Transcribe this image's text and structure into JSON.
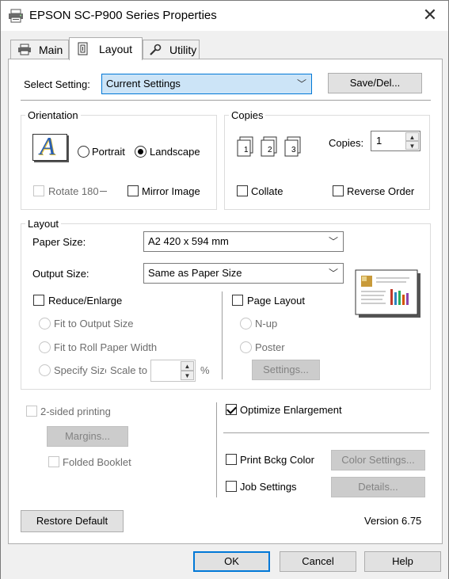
{
  "window": {
    "title": "EPSON SC-P900 Series Properties",
    "close_glyph": "✕"
  },
  "tabs": [
    {
      "label": "Main",
      "icon": "printer-icon"
    },
    {
      "label": "Layout",
      "icon": "page-layout-icon"
    },
    {
      "label": "Utility",
      "icon": "wrench-icon"
    }
  ],
  "select_setting": {
    "label": "Select Setting:",
    "value": "Current Settings",
    "save_label": "Save/Del..."
  },
  "orientation": {
    "group_label": "Orientation",
    "preview_letter": "A",
    "portrait": "Portrait",
    "landscape": "Landscape",
    "rotate": "Rotate 180",
    "mirror": "Mirror Image"
  },
  "copies": {
    "group_label": "Copies",
    "copies_label": "Copies:",
    "value": "1",
    "collate": "Collate",
    "reverse": "Reverse Order",
    "stack_digits": [
      "1",
      "2",
      "3"
    ]
  },
  "layout": {
    "group_label": "Layout",
    "paper_size_label": "Paper Size:",
    "paper_size_value": "A2 420 x 594 mm",
    "output_size_label": "Output Size:",
    "output_size_value": "Same as Paper Size",
    "reduce_enlarge": "Reduce/Enlarge",
    "fit_output": "Fit to Output Size",
    "fit_roll": "Fit to Roll Paper Width",
    "specify_size": "Specify Size",
    "scale_to": "Scale to",
    "percent": "%",
    "page_layout": "Page Layout",
    "n_up": "N-up",
    "poster": "Poster",
    "settings_button": "Settings..."
  },
  "two_sided": {
    "label": "2-sided printing",
    "margins_button": "Margins...",
    "folded_booklet": "Folded Booklet"
  },
  "right_options": {
    "optimize": "Optimize Enlargement",
    "print_bckg": "Print Bckg Color",
    "color_settings_button": "Color Settings...",
    "job_settings": "Job Settings",
    "details_button": "Details..."
  },
  "footer": {
    "restore_default": "Restore Default",
    "version": "Version 6.75"
  },
  "dialog_buttons": {
    "ok": "OK",
    "cancel": "Cancel",
    "help": "Help"
  },
  "colors": {
    "accent": "#0078d7",
    "selection": "#cce4f7",
    "disabled_text": "#6d6d6d"
  }
}
